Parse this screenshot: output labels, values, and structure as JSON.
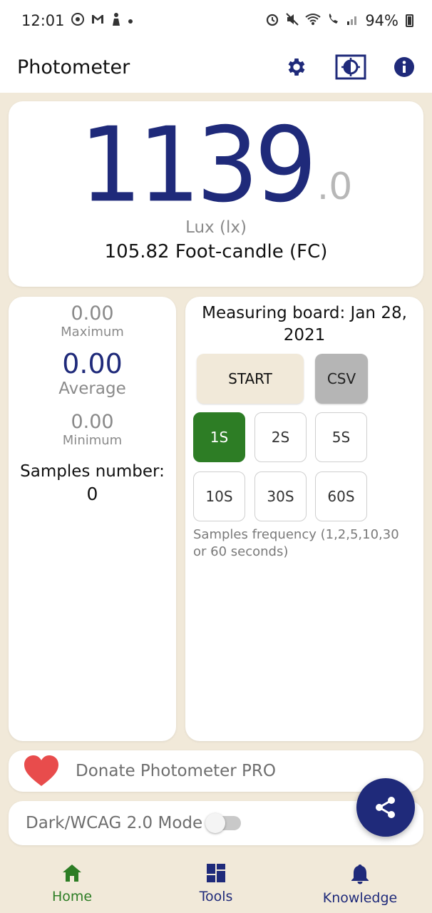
{
  "status_bar": {
    "time": "12:01",
    "battery_percent": "94%",
    "left_icons": [
      "settings-badge-icon",
      "gmail-icon",
      "app-icon",
      "dot-icon"
    ],
    "right_icons": [
      "alarm-icon",
      "mute-icon",
      "wifi-icon",
      "wifi-call-icon",
      "signal-icon",
      "battery-icon"
    ]
  },
  "app_bar": {
    "title": "Photometer",
    "actions": [
      "settings-icon",
      "brightness-icon",
      "info-icon"
    ]
  },
  "reading": {
    "value": "1139",
    "decimal": ".0",
    "unit": "Lux (lx)",
    "footcandle": "105.82 Foot-candle (FC)"
  },
  "stats": {
    "maximum_value": "0.00",
    "maximum_label": "Maximum",
    "average_value": "0.00",
    "average_label": "Average",
    "minimum_value": "0.00",
    "minimum_label": "Minimum",
    "samples_label": "Samples number:",
    "samples_value": "0"
  },
  "board": {
    "title": "Measuring board: Jan 28, 2021",
    "start_label": "START",
    "csv_label": "CSV",
    "frequencies": [
      "1S",
      "2S",
      "5S",
      "10S",
      "30S",
      "60S"
    ],
    "selected_frequency": "1S",
    "frequency_note": "Samples frequency (1,2,5,10,30 or 60 seconds)"
  },
  "donate": {
    "label": "Donate Photometer PRO",
    "icon": "heart-icon"
  },
  "dark_mode": {
    "label": "Dark/WCAG 2.0 Mode",
    "enabled": false
  },
  "fab": {
    "icon": "share-icon"
  },
  "bottom_nav": {
    "items": [
      {
        "label": "Home",
        "icon": "home-icon",
        "active": true
      },
      {
        "label": "Tools",
        "icon": "tools-icon",
        "active": false
      },
      {
        "label": "Knowledge",
        "icon": "bell-icon",
        "active": false
      }
    ]
  },
  "colors": {
    "primary": "#1f2a7a",
    "active_green": "#2d7d25",
    "background": "#f1e9d9",
    "heart": "#e84c4c"
  }
}
